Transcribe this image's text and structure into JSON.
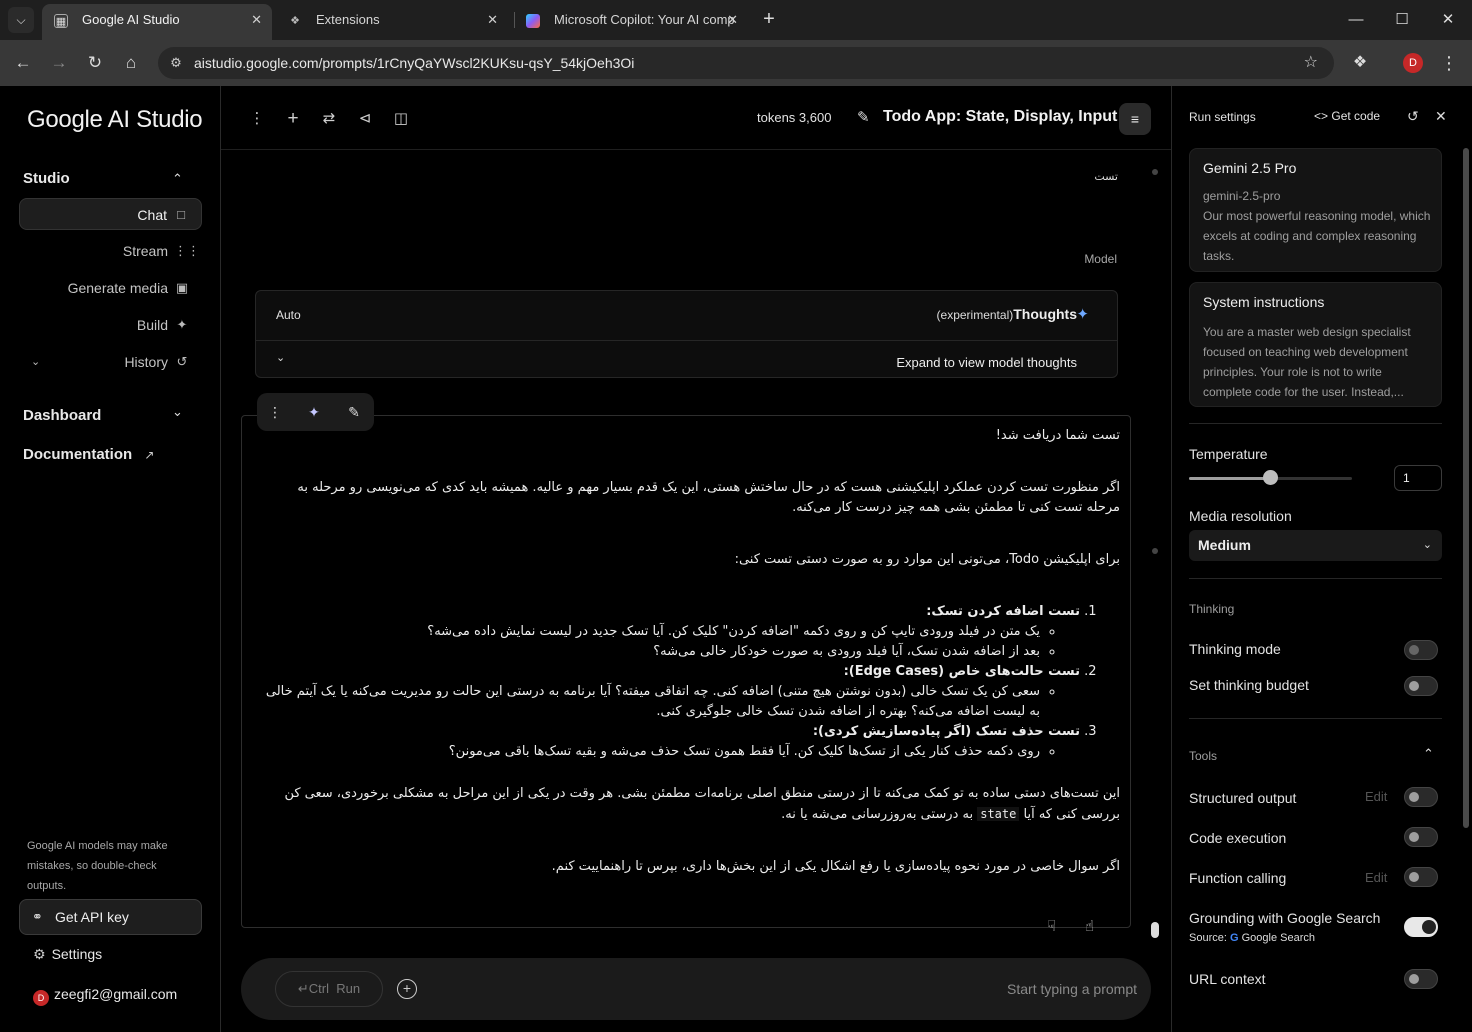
{
  "browser": {
    "tabs": [
      {
        "title": "Google AI Studio",
        "active": true,
        "icon": "page-icon"
      },
      {
        "title": "Extensions",
        "active": false,
        "icon": "puzzle-icon"
      },
      {
        "title": "Microsoft Copilot: Your AI comp",
        "active": false,
        "icon": "copilot-icon"
      }
    ],
    "url": "aistudio.google.com/prompts/1rCnyQaYWscl2KUKsu-qsY_54kjOeh3Oi",
    "profile_initial": "D"
  },
  "sidebar": {
    "logo": "Google AI Studio",
    "studio_label": "Studio",
    "items": [
      {
        "label": "Chat",
        "icon": "chat-icon",
        "active": true
      },
      {
        "label": "Stream",
        "icon": "waveform-icon"
      },
      {
        "label": "Generate media",
        "icon": "image-icon"
      },
      {
        "label": "Build",
        "icon": "build-icon"
      },
      {
        "label": "History",
        "icon": "history-icon"
      }
    ],
    "dashboard_label": "Dashboard",
    "documentation_label": "Documentation",
    "disclaimer": "Google AI models may make mistakes, so double-check outputs.",
    "api_key_label": "Get API key",
    "settings_label": "Settings",
    "account_initial": "D",
    "account_email": "zeegfi2@gmail.com"
  },
  "topbar": {
    "tokens": "tokens 3,600",
    "title": "Todo App: State, Display, Input"
  },
  "chat": {
    "user_message": "تست",
    "model_label": "Model",
    "thoughts": {
      "auto": "Auto",
      "experimental": "(experimental)",
      "title": "Thoughts",
      "expand": "Expand to view model thoughts"
    },
    "response": {
      "intro": "تست شما دریافت شد!",
      "p1": "اگر منظورت تست کردن عملکرد اپلیکیشنی هست که در حال ساختش هستی، این یک قدم بسیار مهم و عالیه. همیشه باید کدی که می‌نویسی رو مرحله به مرحله تست کنی تا مطمئن بشی همه چیز درست کار می‌کنه.",
      "p2": "برای اپلیکیشن Todo، می‌تونی این موارد رو به صورت دستی تست کنی:",
      "steps": [
        {
          "title": "تست اضافه کردن تسک:",
          "items": [
            "یک متن در فیلد ورودی تایپ کن و روی دکمه \"اضافه کردن\" کلیک کن. آیا تسک جدید در لیست نمایش داده می‌شه؟",
            "بعد از اضافه شدن تسک، آیا فیلد ورودی به صورت خودکار خالی می‌شه؟"
          ]
        },
        {
          "title": "تست حالت‌های خاص (Edge Cases):",
          "items": [
            "سعی کن یک تسک خالی (بدون نوشتن هیچ متنی) اضافه کنی. چه اتفاقی میفته؟ آیا برنامه به درستی این حالت رو مدیریت می‌کنه یا یک آیتم خالی به لیست اضافه می‌کنه؟ بهتره از اضافه شدن تسک خالی جلوگیری کنی."
          ]
        },
        {
          "title": "تست حذف تسک (اگر پیاده‌سازیش کردی):",
          "items": [
            "روی دکمه حذف کنار یکی از تسک‌ها کلیک کن. آیا فقط همون تسک حذف می‌شه و بقیه تسک‌ها باقی می‌مونن؟"
          ]
        }
      ],
      "p3_before": "این تست‌های دستی ساده به تو کمک می‌کنه تا از درستی منطق اصلی برنامه‌ات مطمئن بشی. هر وقت در یکی از این مراحل به مشکلی برخوردی، سعی کن بررسی کنی که آیا",
      "p3_code": "state",
      "p3_after": "به درستی به‌روزرسانی می‌شه یا نه.",
      "p4": "اگر سوال خاصی در مورد نحوه پیاده‌سازی یا رفع اشکال یکی از این بخش‌ها داری، بپرس تا راهنماییت کنم."
    }
  },
  "composer": {
    "run_label": "Run",
    "ctrl_label": "Ctrl",
    "placeholder": "Start typing a prompt"
  },
  "run_settings": {
    "title": "Run settings",
    "get_code": "Get code",
    "model": {
      "name": "Gemini 2.5 Pro",
      "id": "gemini-2.5-pro",
      "desc": "Our most powerful reasoning model, which excels at coding and complex reasoning tasks."
    },
    "system_instructions": {
      "title": "System instructions",
      "text": "You are a master web design specialist focused on teaching web development principles. Your role is not to write complete code for the user. Instead,..."
    },
    "temperature_label": "Temperature",
    "temperature_value": "1",
    "temperature_fraction": 0.5,
    "media_resolution_label": "Media resolution",
    "media_resolution_value": "Medium",
    "thinking_section": "Thinking",
    "thinking_mode_label": "Thinking mode",
    "thinking_budget_label": "Set thinking budget",
    "tools_section": "Tools",
    "structured_output_label": "Structured output",
    "code_execution_label": "Code execution",
    "function_calling_label": "Function calling",
    "edit_label": "Edit",
    "grounding_label": "Grounding with Google Search",
    "source_label": "Source:",
    "source_value": "Google Search",
    "url_context_label": "URL context"
  }
}
